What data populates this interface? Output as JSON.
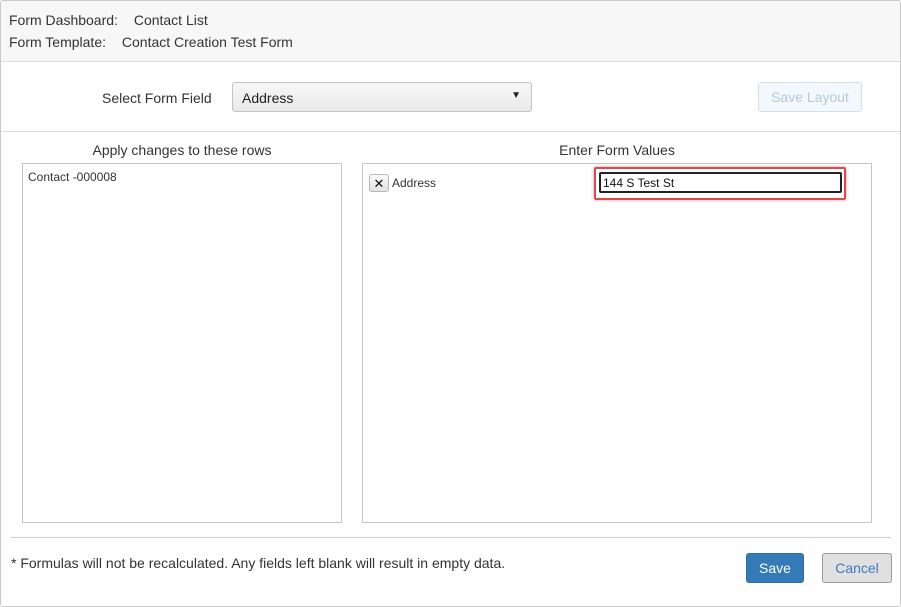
{
  "header": {
    "dashboard_label": "Form Dashboard:",
    "dashboard_value": "Contact List",
    "template_label": "Form Template:",
    "template_value": "Contact Creation Test Form"
  },
  "form_field": {
    "label": "Select Form Field",
    "selected": "Address"
  },
  "toolbar": {
    "save_layout_label": "Save Layout"
  },
  "rows_panel": {
    "title": "Apply changes to these rows",
    "items": [
      "Contact -000008"
    ]
  },
  "values_panel": {
    "title": "Enter Form Values",
    "fields": [
      {
        "label": "Address",
        "value": "144 S Test St"
      }
    ]
  },
  "footer": {
    "note": "* Formulas will not be recalculated. Any fields left blank will result in empty data.",
    "save_label": "Save",
    "cancel_label": "Cancel"
  },
  "colors": {
    "primary": "#337ab7",
    "highlight": "#e0474c"
  }
}
